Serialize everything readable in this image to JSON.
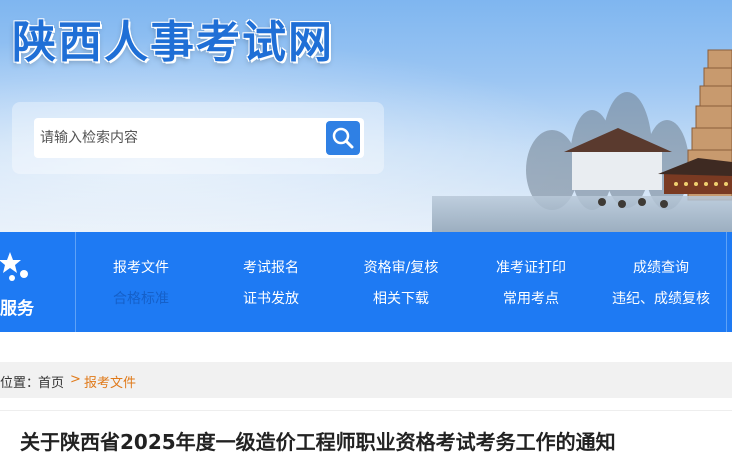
{
  "site": {
    "title": "陕西人事考试网"
  },
  "search": {
    "placeholder": "请输入检索内容",
    "icon": "search-icon"
  },
  "nav": {
    "left_label": "服务",
    "left_icon": "star-icon",
    "row1": [
      "报考文件",
      "考试报名",
      "资格审/复核",
      "准考证打印",
      "成绩查询"
    ],
    "row2": [
      "合格标准",
      "证书发放",
      "相关下载",
      "常用考点",
      "违纪、成绩复核"
    ]
  },
  "breadcrumb": {
    "prefix": "位置：",
    "home": "首页",
    "separator": ">",
    "current": "报考文件"
  },
  "article": {
    "title": "关于陕西省2025年度一级造价工程师职业资格考试考务工作的通知"
  },
  "colors": {
    "nav_bg": "#1e7af3",
    "accent": "#e07a1a",
    "title_blue": "#1f6fd6"
  }
}
